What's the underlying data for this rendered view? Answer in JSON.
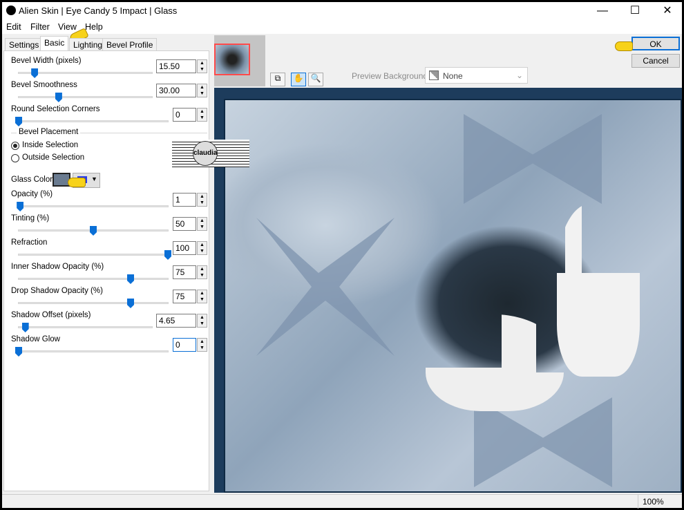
{
  "window": {
    "title": "Alien Skin | Eye Candy 5 Impact | Glass",
    "minimize": "—",
    "maximize": "☐",
    "close": "✕"
  },
  "menu": [
    "Edit",
    "Filter",
    "View",
    "Help"
  ],
  "tabs": [
    {
      "label": "Settings"
    },
    {
      "label": "Basic",
      "active": true
    },
    {
      "label": "Lighting"
    },
    {
      "label": "Bevel Profile"
    }
  ],
  "controls": [
    {
      "label": "Bevel Width (pixels)",
      "value": "15.50",
      "fraction": 0.12
    },
    {
      "label": "Bevel Smoothness",
      "value": "30.00",
      "fraction": 0.3
    },
    {
      "label": "Round Selection Corners",
      "value": "0",
      "fraction": 0
    },
    {
      "label": "Opacity (%)",
      "value": "1",
      "fraction": 0.01
    },
    {
      "label": "Tinting (%)",
      "value": "50",
      "fraction": 0.5
    },
    {
      "label": "Refraction",
      "value": "100",
      "fraction": 1
    },
    {
      "label": "Inner Shadow Opacity (%)",
      "value": "75",
      "fraction": 0.75
    },
    {
      "label": "Drop Shadow Opacity (%)",
      "value": "75",
      "fraction": 0.75
    },
    {
      "label": "Shadow Offset (pixels)",
      "value": "4.65",
      "fraction": 0.05
    },
    {
      "label": "Shadow Glow",
      "value": "0",
      "fraction": 0
    }
  ],
  "placement": {
    "title": "Bevel Placement",
    "options": [
      "Inside Selection",
      "Outside Selection"
    ],
    "selected": 0
  },
  "glass_color": {
    "label": "Glass Color",
    "color": "#6a7b90"
  },
  "buttons": {
    "ok": "OK",
    "cancel": "Cancel"
  },
  "preview_background": {
    "label": "Preview Background:",
    "value": "None"
  },
  "watermark": "claudia",
  "status": {
    "zoom": "100%"
  }
}
